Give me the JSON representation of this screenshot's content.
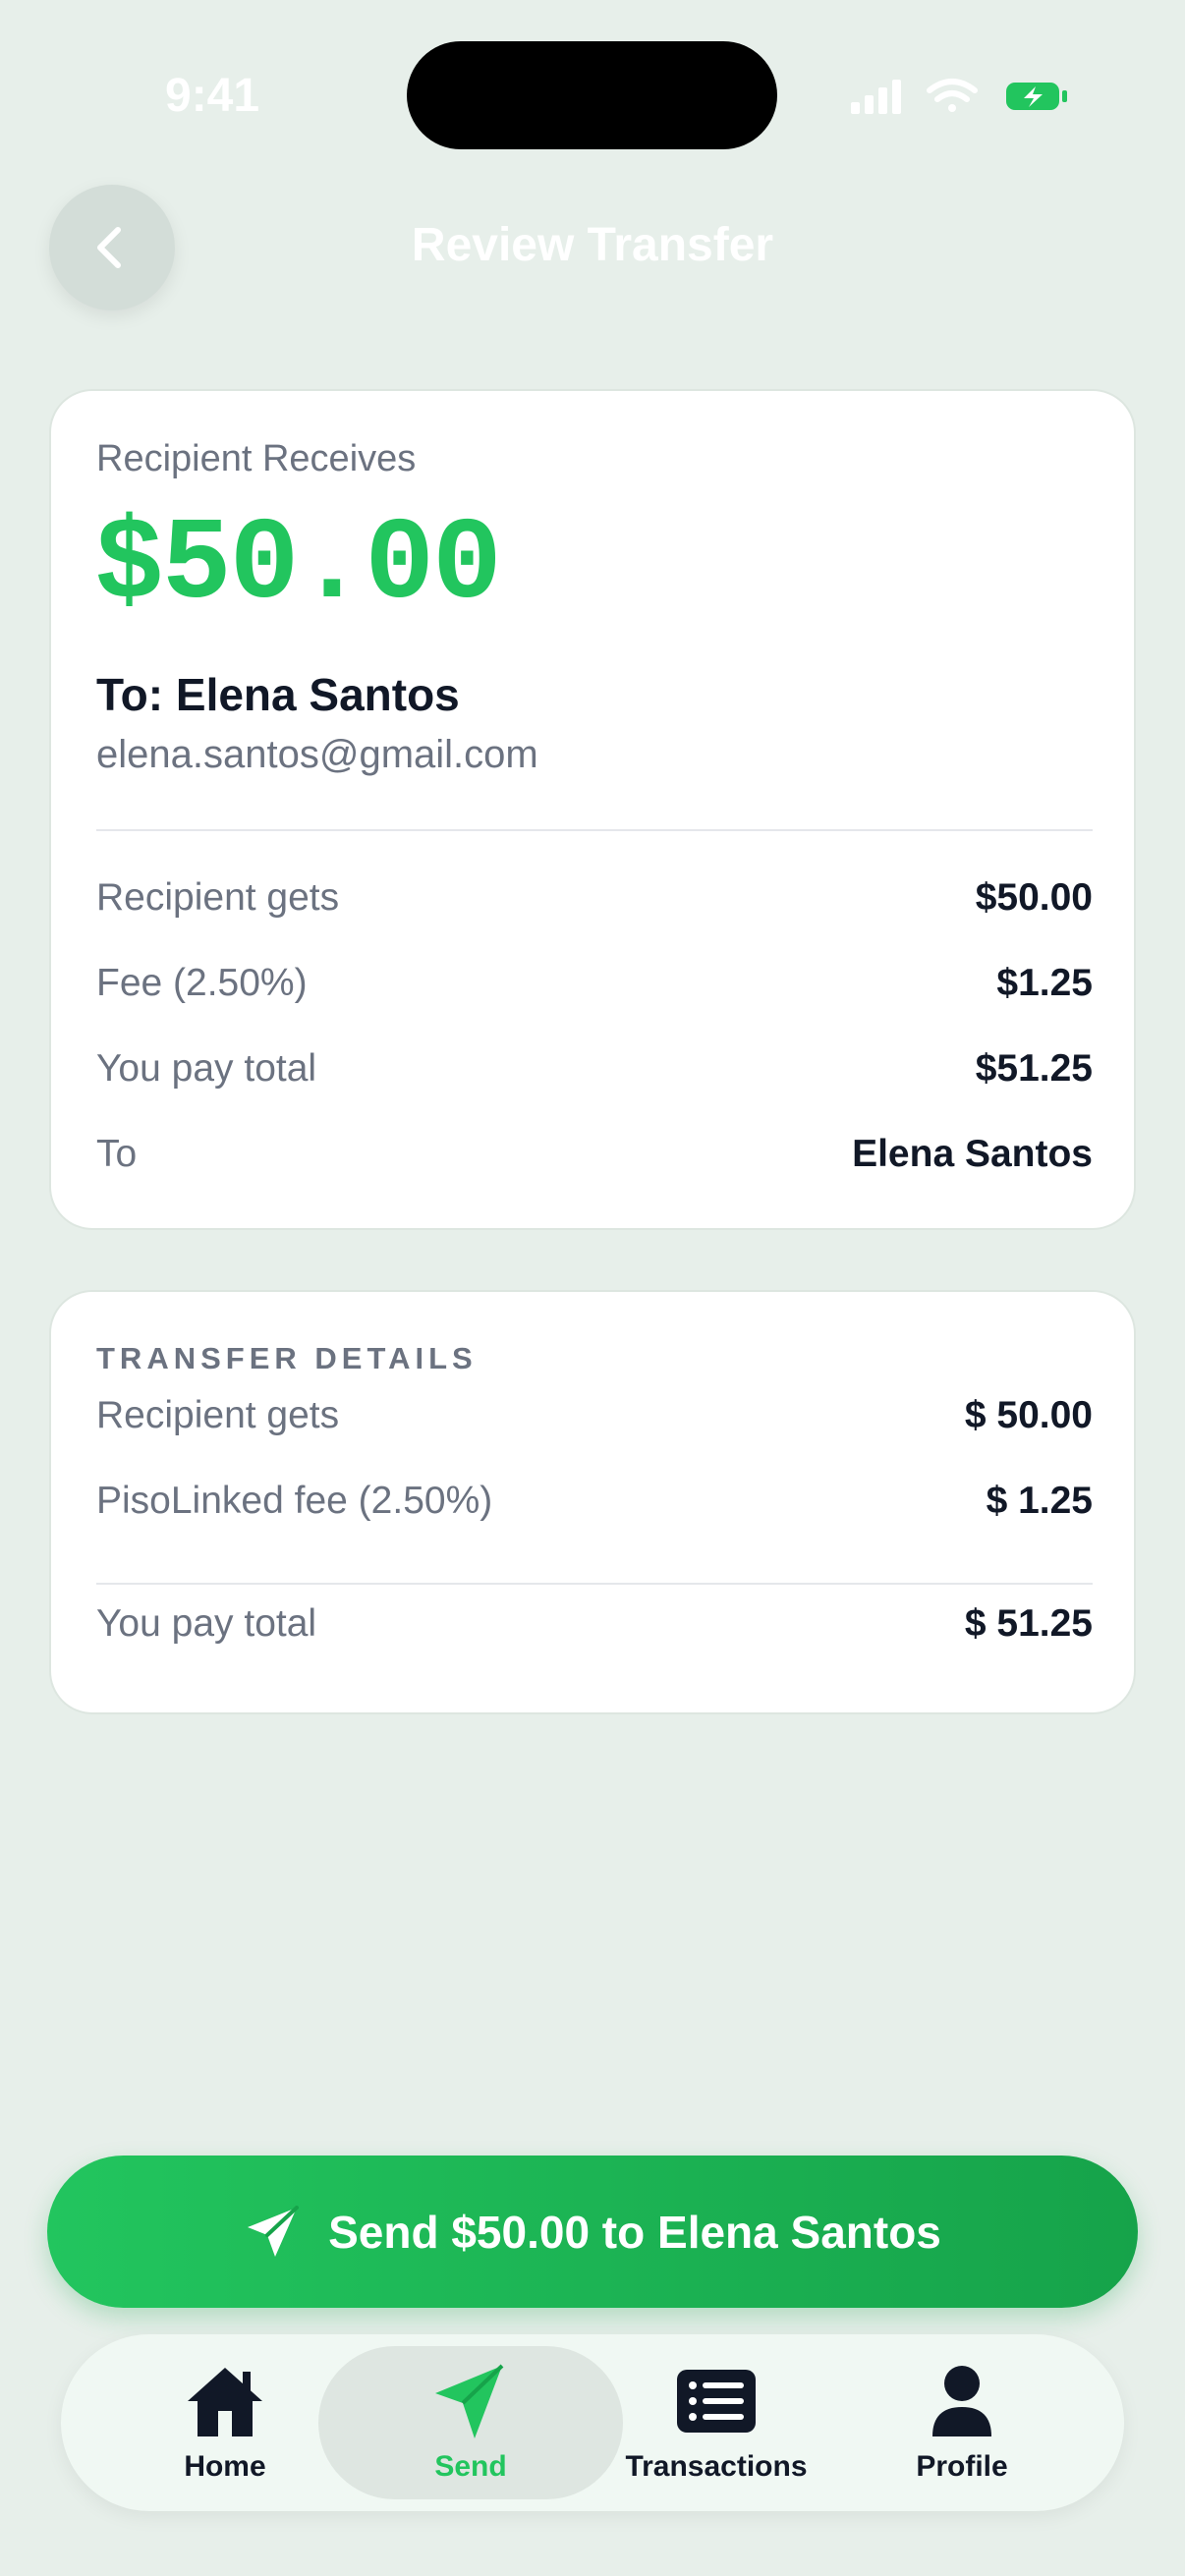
{
  "status_bar": {
    "time": "9:41"
  },
  "header": {
    "title": "Review Transfer"
  },
  "summary": {
    "receives_label": "Recipient Receives",
    "amount": "$50.00",
    "to_line": "To: Elena Santos",
    "email": "elena.santos@gmail.com",
    "rows": [
      {
        "label": "Recipient gets",
        "value": "$50.00"
      },
      {
        "label": "Fee (2.50%)",
        "value": "$1.25"
      },
      {
        "label": "You pay total",
        "value": "$51.25"
      },
      {
        "label": "To",
        "value": "Elena Santos"
      }
    ]
  },
  "details": {
    "title": "TRANSFER DETAILS",
    "rows": [
      {
        "label": "Recipient gets",
        "value": "$ 50.00"
      },
      {
        "label": "PisoLinked fee (2.50%)",
        "value": "$ 1.25"
      }
    ],
    "total": {
      "label": "You pay total",
      "value": "$ 51.25"
    }
  },
  "send_button": {
    "label": "Send $50.00 to Elena Santos"
  },
  "bottom_nav": {
    "items": [
      {
        "label": "Home",
        "icon": "home-icon"
      },
      {
        "label": "Send",
        "icon": "send-icon",
        "active": true
      },
      {
        "label": "Transactions",
        "icon": "list-icon"
      },
      {
        "label": "Profile",
        "icon": "person-icon"
      }
    ]
  },
  "colors": {
    "accent": "#22c55e",
    "accent_dark": "#16a34a",
    "background": "#e7efea"
  }
}
